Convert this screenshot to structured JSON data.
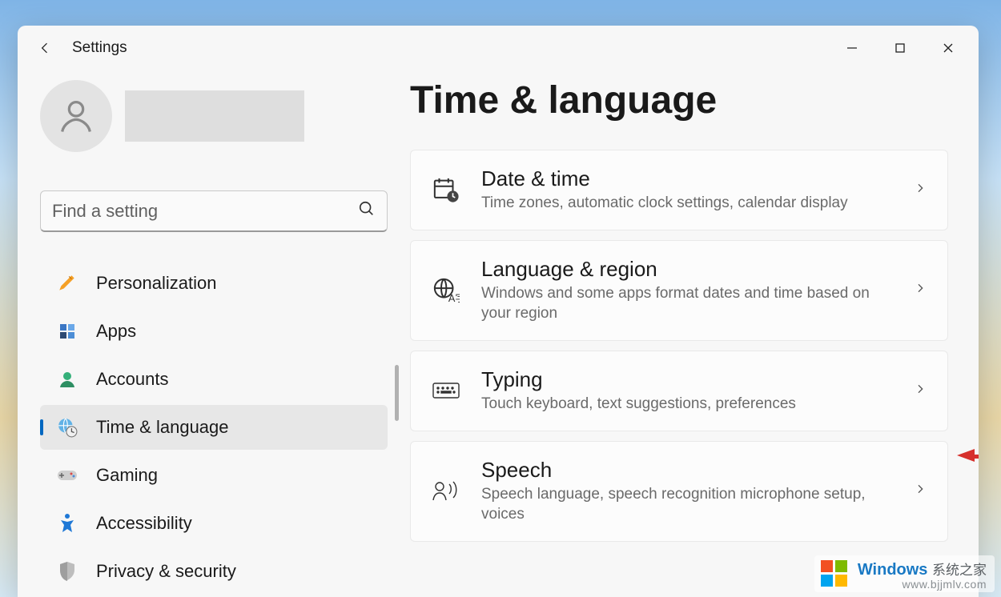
{
  "header": {
    "app_title": "Settings"
  },
  "sidebar": {
    "search_placeholder": "Find a setting",
    "items": [
      {
        "label": "Personalization"
      },
      {
        "label": "Apps"
      },
      {
        "label": "Accounts"
      },
      {
        "label": "Time & language"
      },
      {
        "label": "Gaming"
      },
      {
        "label": "Accessibility"
      },
      {
        "label": "Privacy & security"
      }
    ]
  },
  "main": {
    "title": "Time & language",
    "cards": [
      {
        "title": "Date & time",
        "sub": "Time zones, automatic clock settings, calendar display"
      },
      {
        "title": "Language & region",
        "sub": "Windows and some apps format dates and time based on your region"
      },
      {
        "title": "Typing",
        "sub": "Touch keyboard, text suggestions, preferences"
      },
      {
        "title": "Speech",
        "sub": "Speech language, speech recognition microphone setup, voices"
      }
    ]
  },
  "watermark": {
    "brand": "Windows",
    "brand_suffix": "系统之家",
    "url": "www.bjjmlv.com"
  }
}
